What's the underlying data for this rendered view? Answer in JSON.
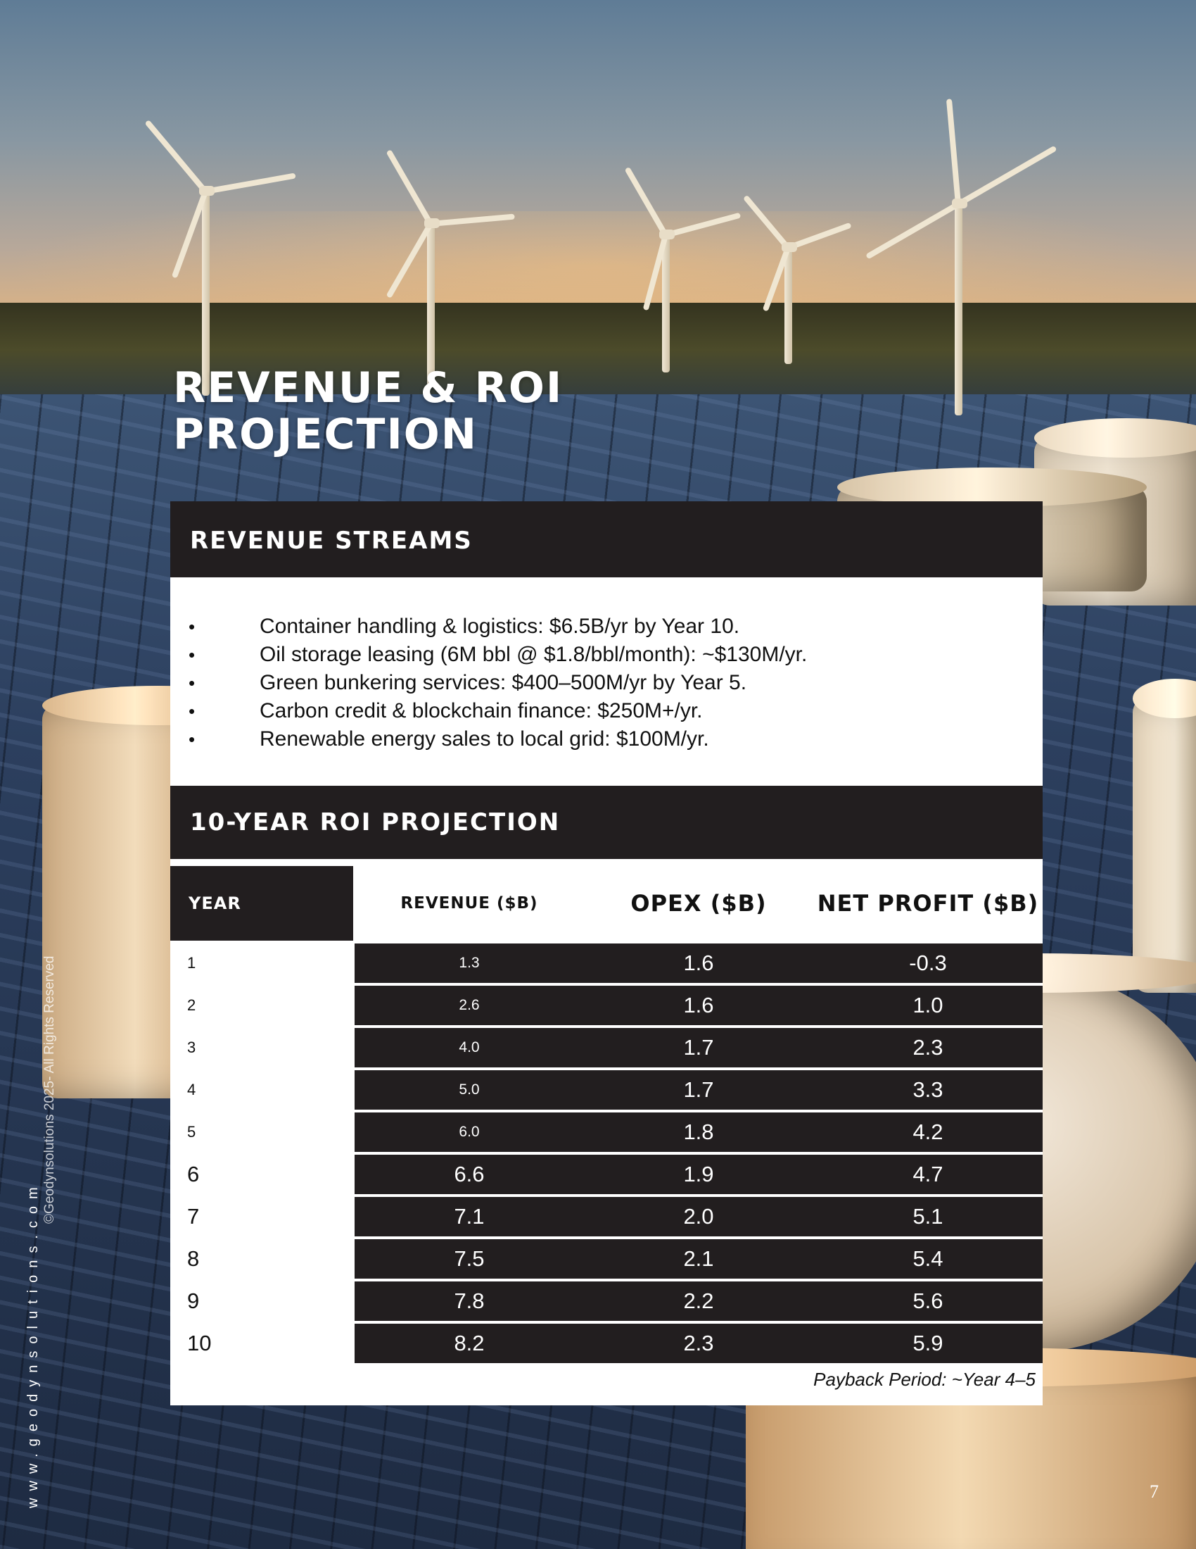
{
  "title": {
    "line1": "REVENUE & ROI",
    "line2": "PROJECTION"
  },
  "revenue_streams": {
    "heading": "REVENUE STREAMS",
    "bullet_glyph": "•",
    "items": [
      "Container handling & logistics: $6.5B/yr by Year 10.",
      "Oil storage leasing (6M bbl @ $1.8/bbl/month): ~$130M/yr.",
      "Green bunkering services: $400–500M/yr by Year 5.",
      "Carbon credit & blockchain finance: $250M+/yr.",
      "Renewable energy sales to local grid: $100M/yr."
    ]
  },
  "roi": {
    "heading": "10-YEAR ROI PROJECTION",
    "columns": [
      "YEAR",
      "REVENUE ($B)",
      "OPEX ($B)",
      "NET PROFIT ($B)"
    ],
    "rows": [
      [
        "1",
        "1.3",
        "1.6",
        "-0.3"
      ],
      [
        "2",
        "2.6",
        "1.6",
        "1.0"
      ],
      [
        "3",
        "4.0",
        "1.7",
        "2.3"
      ],
      [
        "4",
        "5.0",
        "1.7",
        "3.3"
      ],
      [
        "5",
        "6.0",
        "1.8",
        "4.2"
      ],
      [
        "6",
        "6.6",
        "1.9",
        "4.7"
      ],
      [
        "7",
        "7.1",
        "2.0",
        "5.1"
      ],
      [
        "8",
        "7.5",
        "2.1",
        "5.4"
      ],
      [
        "9",
        "7.8",
        "2.2",
        "5.6"
      ],
      [
        "10",
        "8.2",
        "2.3",
        "5.9"
      ]
    ],
    "footnote": "Payback Period: ~Year 4–5"
  },
  "footer": {
    "website": "www.geodynsolutions.com",
    "copyright": "©Geodynsolutions 2025- All Rights Reserved",
    "page_number": "7"
  },
  "colors": {
    "dark": "#221e1f",
    "card": "#ffffff",
    "text": "#111111"
  }
}
